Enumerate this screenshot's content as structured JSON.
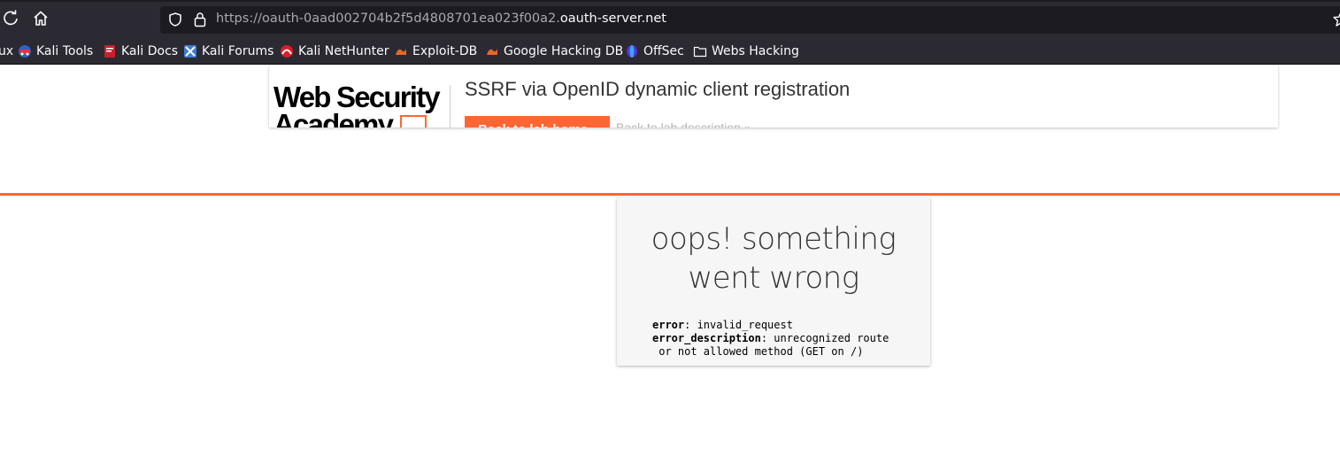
{
  "browser": {
    "url_dim": "https://oauth-0aad002704b2f5d4808701ea023f00a2.",
    "url_domain": "oauth-server.net",
    "bookmarks": [
      {
        "label": "ux",
        "icon": "kali-icon"
      },
      {
        "label": "Kali Tools",
        "icon": "kali-tools-icon"
      },
      {
        "label": "Kali Docs",
        "icon": "kali-docs-icon"
      },
      {
        "label": "Kali Forums",
        "icon": "kali-forums-icon"
      },
      {
        "label": "Kali NetHunter",
        "icon": "nethunter-icon"
      },
      {
        "label": "Exploit-DB",
        "icon": "exploit-db-icon"
      },
      {
        "label": "Google Hacking DB",
        "icon": "ghdb-icon"
      },
      {
        "label": "OffSec",
        "icon": "offsec-icon"
      },
      {
        "label": "Webs Hacking",
        "icon": "folder-icon"
      }
    ]
  },
  "lab_header": {
    "logo_line1": "Web Security",
    "logo_line2": "Academy",
    "title": "SSRF via OpenID dynamic client registration",
    "back_button": "Back to lab home",
    "description_link": "Back to lab description »"
  },
  "error": {
    "title_line1": "oops! something",
    "title_line2": "went wrong",
    "error_label": "error",
    "error_value": ": invalid_request",
    "description_label": "error_description",
    "description_value_line1": ": unrecognized route",
    "description_value_line2": " or not allowed method (GET on /)"
  },
  "colors": {
    "accent": "#ff6633",
    "chrome": "#2b2a33",
    "urlbar": "#1c1b22"
  }
}
